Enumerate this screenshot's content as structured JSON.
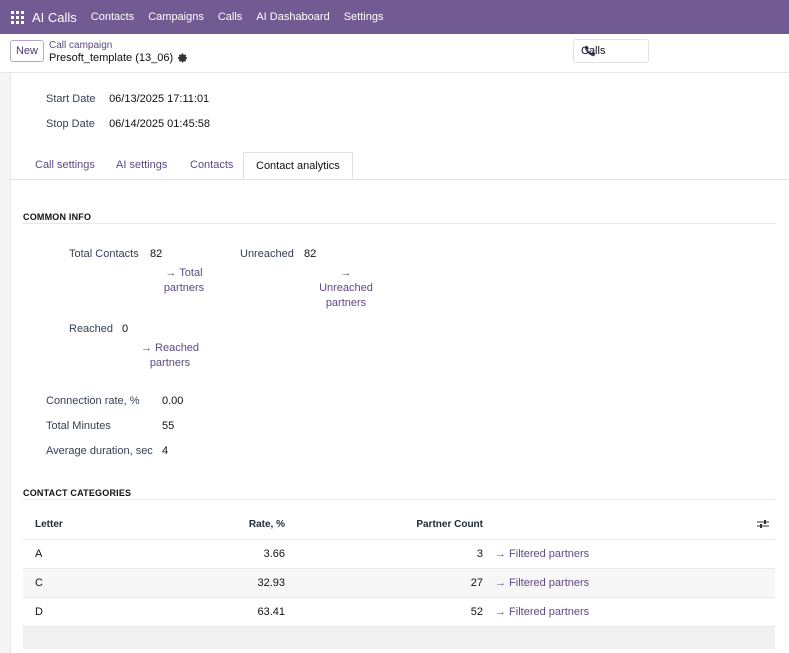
{
  "navbar": {
    "brand": "AI Calls",
    "menu": [
      "Contacts",
      "Campaigns",
      "Calls",
      "AI Dashaboard",
      "Settings"
    ]
  },
  "control": {
    "new_label": "New",
    "breadcrumb_parent": "Call campaign",
    "record_name": "Presoft_template (13_06)",
    "calls_button": "Calls"
  },
  "record": {
    "start_label": "Start Date",
    "start_value": "06/13/2025 17:11:01",
    "stop_label": "Stop Date",
    "stop_value": "06/14/2025 01:45:58"
  },
  "tabs": [
    "Call settings",
    "AI settings",
    "Contacts",
    "Contact analytics"
  ],
  "common_info": {
    "title": "COMMON INFO",
    "total_contacts_label": "Total Contacts",
    "total_contacts_value": "82",
    "total_link": [
      "→ Total",
      "partners"
    ],
    "unreached_label": "Unreached",
    "unreached_value": "82",
    "unreached_link": [
      "→",
      "Unreached",
      "partners"
    ],
    "reached_label": "Reached",
    "reached_value": "0",
    "reached_link": [
      "→ Reached",
      "partners"
    ],
    "connection_rate_label": "Connection rate, %",
    "connection_rate_value": "0.00",
    "total_minutes_label": "Total Minutes",
    "total_minutes_value": "55",
    "avg_duration_label": "Average duration, sec",
    "avg_duration_value": "4"
  },
  "categories": {
    "title": "CONTACT CATEGORIES",
    "columns": [
      "Letter",
      "Rate, %",
      "Partner Count"
    ],
    "rows": [
      {
        "letter": "A",
        "rate": "3.66",
        "count": "3",
        "link": "→ Filtered partners"
      },
      {
        "letter": "C",
        "rate": "32.93",
        "count": "27",
        "link": "→ Filtered partners"
      },
      {
        "letter": "D",
        "rate": "63.41",
        "count": "52",
        "link": "→ Filtered partners"
      }
    ]
  }
}
